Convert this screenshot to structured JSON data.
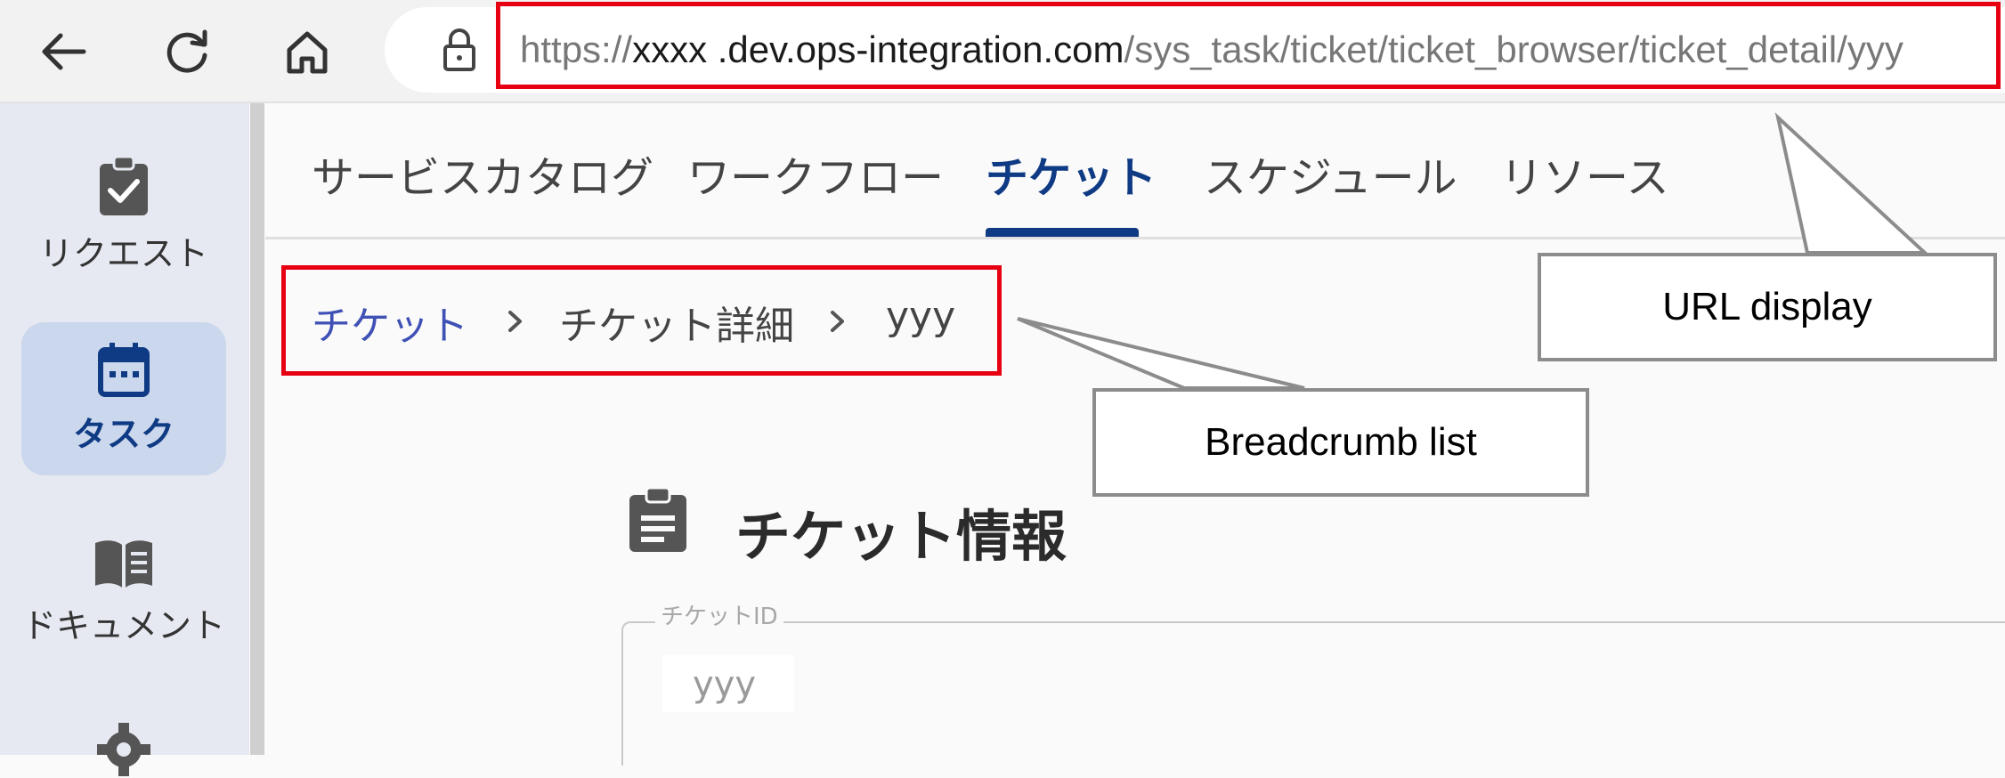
{
  "browser": {
    "url_scheme": "https://",
    "url_host": "xxxx .dev.ops-integration.com",
    "url_path": "/sys_task/ticket/ticket_browser/ticket_detail/yyy",
    "back_icon": "arrow-left-icon",
    "reload_icon": "reload-icon",
    "home_icon": "home-icon",
    "lock_icon": "lock-icon"
  },
  "sidebar": {
    "items": [
      {
        "label": "リクエスト",
        "icon": "clipboard-check-icon"
      },
      {
        "label": "タスク",
        "icon": "calendar-icon",
        "active": true
      },
      {
        "label": "ドキュメント",
        "icon": "book-icon"
      },
      {
        "label": "",
        "icon": "gear-icon"
      }
    ]
  },
  "tabs": {
    "items": [
      "サービスカタログ",
      "ワークフロー",
      "チケット",
      "スケジュール",
      "リソース"
    ],
    "active": "チケット"
  },
  "breadcrumb": {
    "items": [
      "チケット",
      "チケット詳細",
      "yyy"
    ]
  },
  "section": {
    "title": "チケット情報",
    "icon": "clipboard-icon"
  },
  "field": {
    "legend": "チケットID",
    "value": "yyy"
  },
  "callouts": {
    "url": "URL display",
    "breadcrumb": "Breadcrumb list"
  },
  "colors": {
    "highlight_red": "#e60012",
    "accent_blue": "#0f3a84",
    "link_blue": "#3f51b5",
    "sidebar_bg": "#e6e9f1",
    "sidebar_active_bg": "#cbd7ec"
  }
}
